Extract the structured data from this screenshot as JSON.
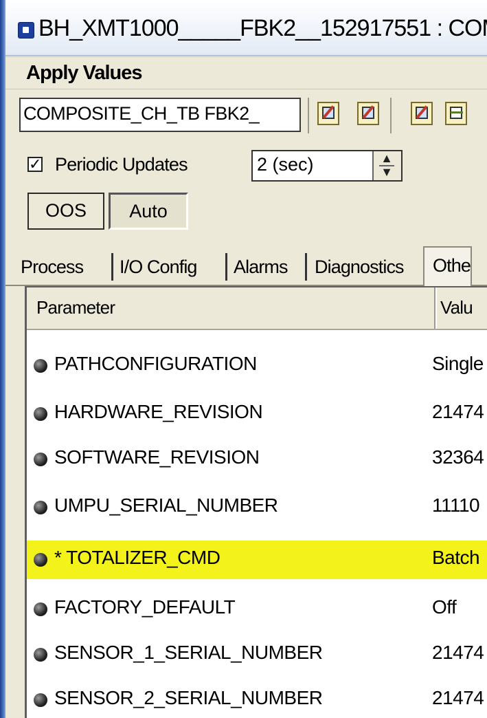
{
  "window": {
    "title": "BH_XMT1000_____FBK2__152917551 : COM",
    "icon": "app-block-icon"
  },
  "menu": {
    "apply_values": "Apply Values"
  },
  "toolbar": {
    "block_selector_value": "COMPOSITE_CH_TB FBK2_",
    "button_icons": [
      "edit-icon",
      "edit-active-icon",
      "calendar-icon",
      "grid-icon"
    ]
  },
  "updates": {
    "periodic_checked": true,
    "check_mark": "✓",
    "periodic_label": "Periodic Updates",
    "interval_value": "2 (sec)",
    "spin_up": "▲",
    "spin_down": "▼"
  },
  "mode": {
    "oos_label": "OOS",
    "auto_label": "Auto"
  },
  "tabs": [
    {
      "label": "Process"
    },
    {
      "label": "I/O Config"
    },
    {
      "label": "Alarms"
    },
    {
      "label": "Diagnostics"
    },
    {
      "label": "Othe"
    }
  ],
  "table": {
    "columns": [
      "Parameter",
      "Valu"
    ],
    "rows": [
      {
        "name": "PATHCONFIGURATION",
        "value": "Single",
        "highlighted": false
      },
      {
        "name": "HARDWARE_REVISION",
        "value": "21474",
        "highlighted": false
      },
      {
        "name": "SOFTWARE_REVISION",
        "value": "32364",
        "highlighted": false
      },
      {
        "name": "UMPU_SERIAL_NUMBER",
        "value": "11110",
        "highlighted": false
      },
      {
        "name": "* TOTALIZER_CMD",
        "value": "Batch",
        "highlighted": true
      },
      {
        "name": "FACTORY_DEFAULT",
        "value": "Off",
        "highlighted": false
      },
      {
        "name": "SENSOR_1_SERIAL_NUMBER",
        "value": "21474",
        "highlighted": false
      },
      {
        "name": "SENSOR_2_SERIAL_NUMBER",
        "value": "21474",
        "highlighted": false
      }
    ],
    "highlight_color": "#f3f31b"
  }
}
